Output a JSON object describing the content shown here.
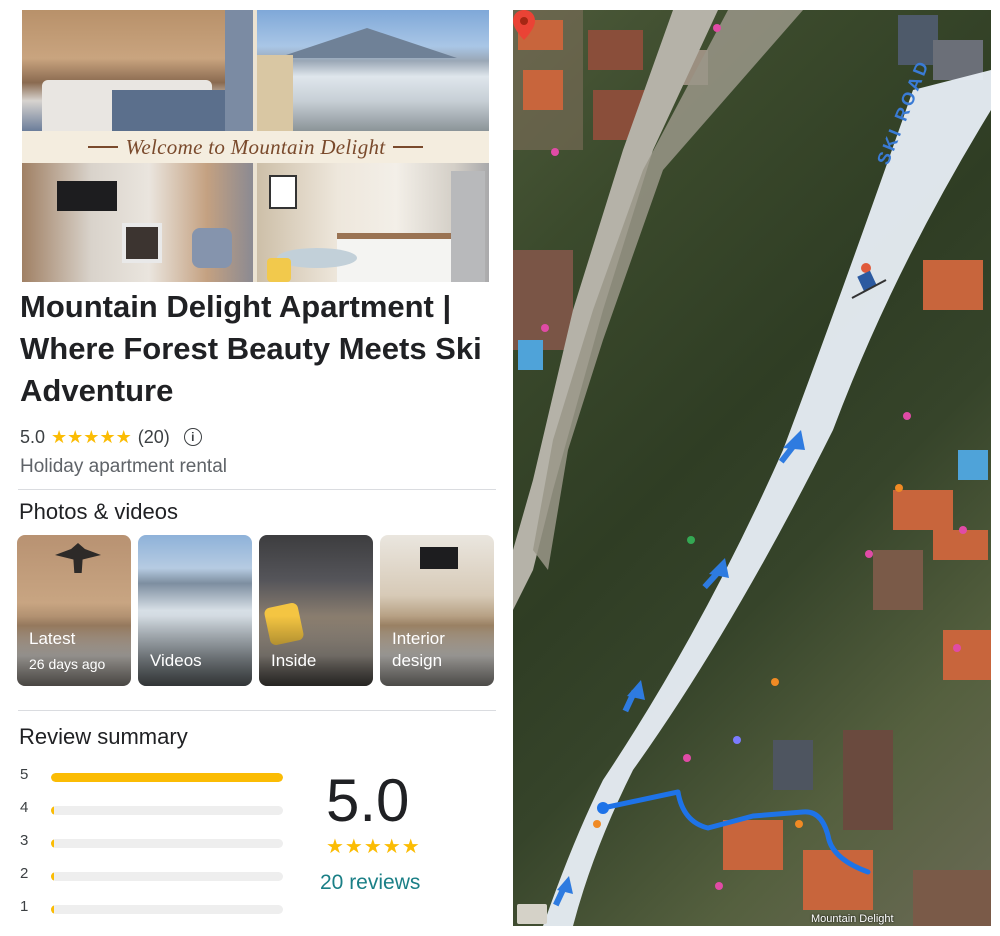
{
  "hero": {
    "banner_text": "Welcome to Mountain Delight"
  },
  "place": {
    "title": "Mountain Delight Apartment | Where Forest Beauty Meets Ski Adventure",
    "rating": "5.0",
    "stars": "★★★★★",
    "review_count": "(20)",
    "category": "Holiday apartment rental"
  },
  "photos": {
    "heading": "Photos & videos",
    "tiles": [
      {
        "label": "Latest",
        "sub": "26 days ago"
      },
      {
        "label": "Videos",
        "sub": ""
      },
      {
        "label": "Inside",
        "sub": ""
      },
      {
        "label": "Interior design",
        "sub": ""
      }
    ]
  },
  "reviews": {
    "heading": "Review summary",
    "distribution": [
      {
        "stars": "5",
        "fraction": 1.0
      },
      {
        "stars": "4",
        "fraction": 0.0
      },
      {
        "stars": "3",
        "fraction": 0.0
      },
      {
        "stars": "2",
        "fraction": 0.0
      },
      {
        "stars": "1",
        "fraction": 0.0
      }
    ],
    "score": "5.0",
    "stars": "★★★★★",
    "link": "20 reviews"
  },
  "map": {
    "overlay_text": "SKI ROAD",
    "pin_label": "Mountain Delight",
    "route_color": "#1e73e8",
    "ski_path_color": "#e8eef5"
  },
  "colors": {
    "star": "#fbbc04",
    "link": "#1a7f86",
    "divider": "#dadce0"
  }
}
